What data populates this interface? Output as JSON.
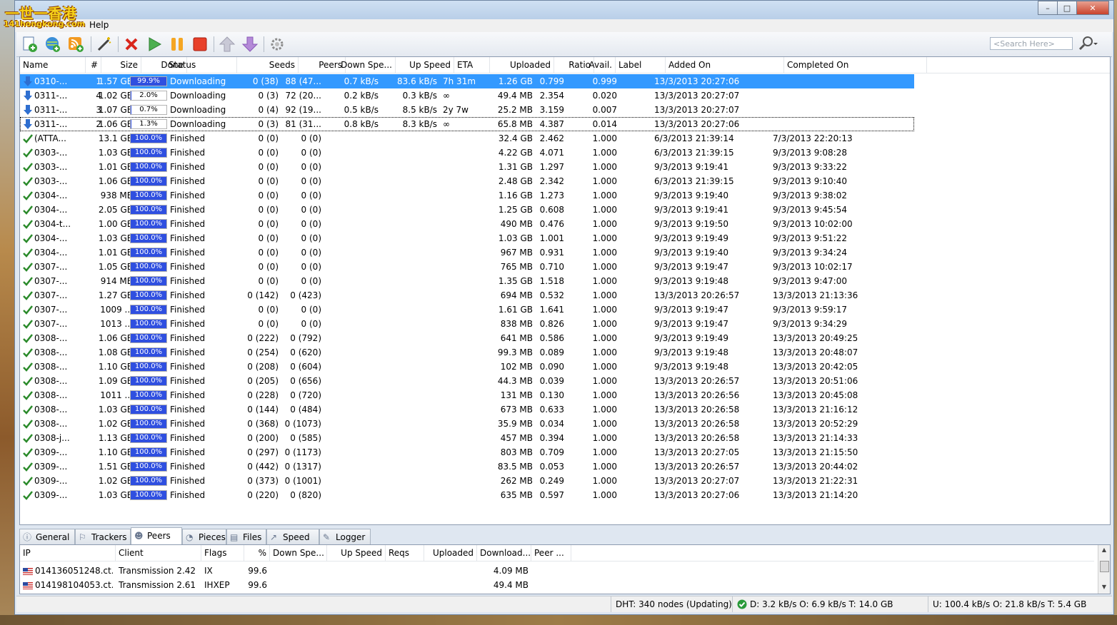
{
  "watermark": {
    "line1": "一世一香港",
    "line2": "141hongkong.com"
  },
  "menu": {
    "help": "Help"
  },
  "search": {
    "placeholder": "<Search Here>"
  },
  "columns": [
    {
      "key": "name",
      "label": "Name"
    },
    {
      "key": "num",
      "label": "#"
    },
    {
      "key": "size",
      "label": "Size"
    },
    {
      "key": "done",
      "label": "Done"
    },
    {
      "key": "status",
      "label": "Status"
    },
    {
      "key": "seeds",
      "label": "Seeds"
    },
    {
      "key": "peers",
      "label": "Peers"
    },
    {
      "key": "down",
      "label": "Down Spe..."
    },
    {
      "key": "up",
      "label": "Up Speed"
    },
    {
      "key": "eta",
      "label": "ETA"
    },
    {
      "key": "uploaded",
      "label": "Uploaded"
    },
    {
      "key": "ratio",
      "label": "Ratio"
    },
    {
      "key": "avail",
      "label": "Avail."
    },
    {
      "key": "label",
      "label": "Label"
    },
    {
      "key": "added",
      "label": "Added On"
    },
    {
      "key": "completed",
      "label": "Completed On"
    }
  ],
  "torrents": [
    {
      "icon": "download-arrow-icon",
      "name": "0310-...",
      "num": "1",
      "size": "1.57 GB",
      "done": "99.9%",
      "progress": 0.999,
      "status": "Downloading",
      "seeds": "0 (38)",
      "peers": "88 (47...",
      "down": "0.7 kB/s",
      "up": "83.6 kB/s",
      "eta": "7h 31m",
      "uploaded": "1.26 GB",
      "ratio": "0.799",
      "avail": "0.999",
      "added": "13/3/2013 20:27:06",
      "completed": ""
    },
    {
      "icon": "download-arrow-icon",
      "name": "0311-...",
      "num": "4",
      "size": "1.02 GB",
      "done": "2.0%",
      "progress": 0.02,
      "status": "Downloading",
      "seeds": "0 (3)",
      "peers": "72 (20...",
      "down": "0.2 kB/s",
      "up": "0.3 kB/s",
      "eta": "∞",
      "uploaded": "49.4 MB",
      "ratio": "2.354",
      "avail": "0.020",
      "added": "13/3/2013 20:27:07",
      "completed": ""
    },
    {
      "icon": "download-arrow-icon",
      "name": "0311-...",
      "num": "3",
      "size": "1.07 GB",
      "done": "0.7%",
      "progress": 0.007,
      "status": "Downloading",
      "seeds": "0 (4)",
      "peers": "92 (19...",
      "down": "0.5 kB/s",
      "up": "8.5 kB/s",
      "eta": "2y 7w",
      "uploaded": "25.2 MB",
      "ratio": "3.159",
      "avail": "0.007",
      "added": "13/3/2013 20:27:07",
      "completed": ""
    },
    {
      "icon": "download-arrow-icon",
      "name": "0311-...",
      "num": "2",
      "size": "1.06 GB",
      "done": "1.3%",
      "progress": 0.013,
      "status": "Downloading",
      "seeds": "0 (3)",
      "peers": "81 (31...",
      "down": "0.8 kB/s",
      "up": "8.3 kB/s",
      "eta": "∞",
      "uploaded": "65.8 MB",
      "ratio": "4.387",
      "avail": "0.014",
      "added": "13/3/2013 20:27:06",
      "completed": ""
    },
    {
      "icon": "check-icon",
      "name": "(ATTA...",
      "num": "",
      "size": "13.1 GB",
      "done": "100.0%",
      "progress": 1,
      "status": "Finished",
      "seeds": "0 (0)",
      "peers": "0 (0)",
      "down": "",
      "up": "",
      "eta": "",
      "uploaded": "32.4 GB",
      "ratio": "2.462",
      "avail": "1.000",
      "added": "6/3/2013 21:39:14",
      "completed": "7/3/2013 22:20:13"
    },
    {
      "icon": "check-icon",
      "name": "0303-...",
      "num": "",
      "size": "1.03 GB",
      "done": "100.0%",
      "progress": 1,
      "status": "Finished",
      "seeds": "0 (0)",
      "peers": "0 (0)",
      "down": "",
      "up": "",
      "eta": "",
      "uploaded": "4.22 GB",
      "ratio": "4.071",
      "avail": "1.000",
      "added": "6/3/2013 21:39:15",
      "completed": "9/3/2013 9:08:28"
    },
    {
      "icon": "check-icon",
      "name": "0303-...",
      "num": "",
      "size": "1.01 GB",
      "done": "100.0%",
      "progress": 1,
      "status": "Finished",
      "seeds": "0 (0)",
      "peers": "0 (0)",
      "down": "",
      "up": "",
      "eta": "",
      "uploaded": "1.31 GB",
      "ratio": "1.297",
      "avail": "1.000",
      "added": "9/3/2013 9:19:41",
      "completed": "9/3/2013 9:33:22"
    },
    {
      "icon": "check-icon",
      "name": "0303-...",
      "num": "",
      "size": "1.06 GB",
      "done": "100.0%",
      "progress": 1,
      "status": "Finished",
      "seeds": "0 (0)",
      "peers": "0 (0)",
      "down": "",
      "up": "",
      "eta": "",
      "uploaded": "2.48 GB",
      "ratio": "2.342",
      "avail": "1.000",
      "added": "6/3/2013 21:39:15",
      "completed": "9/3/2013 9:10:40"
    },
    {
      "icon": "check-icon",
      "name": "0304-...",
      "num": "",
      "size": "938 MB",
      "done": "100.0%",
      "progress": 1,
      "status": "Finished",
      "seeds": "0 (0)",
      "peers": "0 (0)",
      "down": "",
      "up": "",
      "eta": "",
      "uploaded": "1.16 GB",
      "ratio": "1.273",
      "avail": "1.000",
      "added": "9/3/2013 9:19:40",
      "completed": "9/3/2013 9:38:02"
    },
    {
      "icon": "check-icon",
      "name": "0304-...",
      "num": "",
      "size": "2.05 GB",
      "done": "100.0%",
      "progress": 1,
      "status": "Finished",
      "seeds": "0 (0)",
      "peers": "0 (0)",
      "down": "",
      "up": "",
      "eta": "",
      "uploaded": "1.25 GB",
      "ratio": "0.608",
      "avail": "1.000",
      "added": "9/3/2013 9:19:41",
      "completed": "9/3/2013 9:45:54"
    },
    {
      "icon": "check-icon",
      "name": "0304-t...",
      "num": "",
      "size": "1.00 GB",
      "done": "100.0%",
      "progress": 1,
      "status": "Finished",
      "seeds": "0 (0)",
      "peers": "0 (0)",
      "down": "",
      "up": "",
      "eta": "",
      "uploaded": "490 MB",
      "ratio": "0.476",
      "avail": "1.000",
      "added": "9/3/2013 9:19:50",
      "completed": "9/3/2013 10:02:00"
    },
    {
      "icon": "check-icon",
      "name": "0304-...",
      "num": "",
      "size": "1.03 GB",
      "done": "100.0%",
      "progress": 1,
      "status": "Finished",
      "seeds": "0 (0)",
      "peers": "0 (0)",
      "down": "",
      "up": "",
      "eta": "",
      "uploaded": "1.03 GB",
      "ratio": "1.001",
      "avail": "1.000",
      "added": "9/3/2013 9:19:49",
      "completed": "9/3/2013 9:51:22"
    },
    {
      "icon": "check-icon",
      "name": "0304-...",
      "num": "",
      "size": "1.01 GB",
      "done": "100.0%",
      "progress": 1,
      "status": "Finished",
      "seeds": "0 (0)",
      "peers": "0 (0)",
      "down": "",
      "up": "",
      "eta": "",
      "uploaded": "967 MB",
      "ratio": "0.931",
      "avail": "1.000",
      "added": "9/3/2013 9:19:40",
      "completed": "9/3/2013 9:34:24"
    },
    {
      "icon": "check-icon",
      "name": "0307-...",
      "num": "",
      "size": "1.05 GB",
      "done": "100.0%",
      "progress": 1,
      "status": "Finished",
      "seeds": "0 (0)",
      "peers": "0 (0)",
      "down": "",
      "up": "",
      "eta": "",
      "uploaded": "765 MB",
      "ratio": "0.710",
      "avail": "1.000",
      "added": "9/3/2013 9:19:47",
      "completed": "9/3/2013 10:02:17"
    },
    {
      "icon": "check-icon",
      "name": "0307-...",
      "num": "",
      "size": "914 MB",
      "done": "100.0%",
      "progress": 1,
      "status": "Finished",
      "seeds": "0 (0)",
      "peers": "0 (0)",
      "down": "",
      "up": "",
      "eta": "",
      "uploaded": "1.35 GB",
      "ratio": "1.518",
      "avail": "1.000",
      "added": "9/3/2013 9:19:48",
      "completed": "9/3/2013 9:47:00"
    },
    {
      "icon": "check-icon",
      "name": "0307-...",
      "num": "",
      "size": "1.27 GB",
      "done": "100.0%",
      "progress": 1,
      "status": "Finished",
      "seeds": "0 (142)",
      "peers": "0 (423)",
      "down": "",
      "up": "",
      "eta": "",
      "uploaded": "694 MB",
      "ratio": "0.532",
      "avail": "1.000",
      "added": "13/3/2013 20:26:57",
      "completed": "13/3/2013 21:13:36"
    },
    {
      "icon": "check-icon",
      "name": "0307-...",
      "num": "",
      "size": "1009 ...",
      "done": "100.0%",
      "progress": 1,
      "status": "Finished",
      "seeds": "0 (0)",
      "peers": "0 (0)",
      "down": "",
      "up": "",
      "eta": "",
      "uploaded": "1.61 GB",
      "ratio": "1.641",
      "avail": "1.000",
      "added": "9/3/2013 9:19:47",
      "completed": "9/3/2013 9:59:17"
    },
    {
      "icon": "check-icon",
      "name": "0307-...",
      "num": "",
      "size": "1013 ...",
      "done": "100.0%",
      "progress": 1,
      "status": "Finished",
      "seeds": "0 (0)",
      "peers": "0 (0)",
      "down": "",
      "up": "",
      "eta": "",
      "uploaded": "838 MB",
      "ratio": "0.826",
      "avail": "1.000",
      "added": "9/3/2013 9:19:47",
      "completed": "9/3/2013 9:34:29"
    },
    {
      "icon": "check-icon",
      "name": "0308-...",
      "num": "",
      "size": "1.06 GB",
      "done": "100.0%",
      "progress": 1,
      "status": "Finished",
      "seeds": "0 (222)",
      "peers": "0 (792)",
      "down": "",
      "up": "",
      "eta": "",
      "uploaded": "641 MB",
      "ratio": "0.586",
      "avail": "1.000",
      "added": "9/3/2013 9:19:49",
      "completed": "13/3/2013 20:49:25"
    },
    {
      "icon": "check-icon",
      "name": "0308-...",
      "num": "",
      "size": "1.08 GB",
      "done": "100.0%",
      "progress": 1,
      "status": "Finished",
      "seeds": "0 (254)",
      "peers": "0 (620)",
      "down": "",
      "up": "",
      "eta": "",
      "uploaded": "99.3 MB",
      "ratio": "0.089",
      "avail": "1.000",
      "added": "9/3/2013 9:19:48",
      "completed": "13/3/2013 20:48:07"
    },
    {
      "icon": "check-icon",
      "name": "0308-...",
      "num": "",
      "size": "1.10 GB",
      "done": "100.0%",
      "progress": 1,
      "status": "Finished",
      "seeds": "0 (208)",
      "peers": "0 (604)",
      "down": "",
      "up": "",
      "eta": "",
      "uploaded": "102 MB",
      "ratio": "0.090",
      "avail": "1.000",
      "added": "9/3/2013 9:19:48",
      "completed": "13/3/2013 20:42:05"
    },
    {
      "icon": "check-icon",
      "name": "0308-...",
      "num": "",
      "size": "1.09 GB",
      "done": "100.0%",
      "progress": 1,
      "status": "Finished",
      "seeds": "0 (205)",
      "peers": "0 (656)",
      "down": "",
      "up": "",
      "eta": "",
      "uploaded": "44.3 MB",
      "ratio": "0.039",
      "avail": "1.000",
      "added": "13/3/2013 20:26:57",
      "completed": "13/3/2013 20:51:06"
    },
    {
      "icon": "check-icon",
      "name": "0308-...",
      "num": "",
      "size": "1011 ...",
      "done": "100.0%",
      "progress": 1,
      "status": "Finished",
      "seeds": "0 (228)",
      "peers": "0 (720)",
      "down": "",
      "up": "",
      "eta": "",
      "uploaded": "131 MB",
      "ratio": "0.130",
      "avail": "1.000",
      "added": "13/3/2013 20:26:56",
      "completed": "13/3/2013 20:45:08"
    },
    {
      "icon": "check-icon",
      "name": "0308-...",
      "num": "",
      "size": "1.03 GB",
      "done": "100.0%",
      "progress": 1,
      "status": "Finished",
      "seeds": "0 (144)",
      "peers": "0 (484)",
      "down": "",
      "up": "",
      "eta": "",
      "uploaded": "673 MB",
      "ratio": "0.633",
      "avail": "1.000",
      "added": "13/3/2013 20:26:58",
      "completed": "13/3/2013 21:16:12"
    },
    {
      "icon": "check-icon",
      "name": "0308-...",
      "num": "",
      "size": "1.02 GB",
      "done": "100.0%",
      "progress": 1,
      "status": "Finished",
      "seeds": "0 (368)",
      "peers": "0 (1073)",
      "down": "",
      "up": "",
      "eta": "",
      "uploaded": "35.9 MB",
      "ratio": "0.034",
      "avail": "1.000",
      "added": "13/3/2013 20:26:58",
      "completed": "13/3/2013 20:52:29"
    },
    {
      "icon": "check-icon",
      "name": "0308-j...",
      "num": "",
      "size": "1.13 GB",
      "done": "100.0%",
      "progress": 1,
      "status": "Finished",
      "seeds": "0 (200)",
      "peers": "0 (585)",
      "down": "",
      "up": "",
      "eta": "",
      "uploaded": "457 MB",
      "ratio": "0.394",
      "avail": "1.000",
      "added": "13/3/2013 20:26:58",
      "completed": "13/3/2013 21:14:33"
    },
    {
      "icon": "check-icon",
      "name": "0309-...",
      "num": "",
      "size": "1.10 GB",
      "done": "100.0%",
      "progress": 1,
      "status": "Finished",
      "seeds": "0 (297)",
      "peers": "0 (1173)",
      "down": "",
      "up": "",
      "eta": "",
      "uploaded": "803 MB",
      "ratio": "0.709",
      "avail": "1.000",
      "added": "13/3/2013 20:27:05",
      "completed": "13/3/2013 21:15:50"
    },
    {
      "icon": "check-icon",
      "name": "0309-...",
      "num": "",
      "size": "1.51 GB",
      "done": "100.0%",
      "progress": 1,
      "status": "Finished",
      "seeds": "0 (442)",
      "peers": "0 (1317)",
      "down": "",
      "up": "",
      "eta": "",
      "uploaded": "83.5 MB",
      "ratio": "0.053",
      "avail": "1.000",
      "added": "13/3/2013 20:26:57",
      "completed": "13/3/2013 20:44:02"
    },
    {
      "icon": "check-icon",
      "name": "0309-...",
      "num": "",
      "size": "1.02 GB",
      "done": "100.0%",
      "progress": 1,
      "status": "Finished",
      "seeds": "0 (373)",
      "peers": "0 (1001)",
      "down": "",
      "up": "",
      "eta": "",
      "uploaded": "262 MB",
      "ratio": "0.249",
      "avail": "1.000",
      "added": "13/3/2013 20:27:07",
      "completed": "13/3/2013 21:22:31"
    },
    {
      "icon": "check-icon",
      "name": "0309-...",
      "num": "",
      "size": "1.03 GB",
      "done": "100.0%",
      "progress": 1,
      "status": "Finished",
      "seeds": "0 (220)",
      "peers": "0 (820)",
      "down": "",
      "up": "",
      "eta": "",
      "uploaded": "635 MB",
      "ratio": "0.597",
      "avail": "1.000",
      "added": "13/3/2013 20:27:06",
      "completed": "13/3/2013 21:14:20"
    }
  ],
  "tabs": [
    {
      "label": "General",
      "icon": "info-icon"
    },
    {
      "label": "Trackers",
      "icon": "trackers-icon"
    },
    {
      "label": "Peers",
      "icon": "peers-icon",
      "active": true
    },
    {
      "label": "Pieces",
      "icon": "pieces-icon"
    },
    {
      "label": "Files",
      "icon": "files-icon"
    },
    {
      "label": "Speed",
      "icon": "speed-icon"
    },
    {
      "label": "Logger",
      "icon": "logger-icon"
    }
  ],
  "peer_columns": [
    "IP",
    "Client",
    "Flags",
    "%",
    "Down Spe...",
    "Up Speed",
    "Reqs",
    "Uploaded",
    "Download...",
    "Peer ..."
  ],
  "peers": [
    {
      "ip": "014136051248.ct...",
      "client": "Transmission 2.42",
      "flags": "IX",
      "pct": "99.6",
      "down": "",
      "up": "",
      "reqs": "",
      "uploaded": "",
      "downloaded": "4.09 MB",
      "peer": ""
    },
    {
      "ip": "014198104053.ct...",
      "client": "Transmission 2.61",
      "flags": "IHXEP",
      "pct": "99.6",
      "down": "",
      "up": "",
      "reqs": "",
      "uploaded": "",
      "downloaded": "49.4 MB",
      "peer": ""
    }
  ],
  "status": {
    "dht": "DHT: 340 nodes (Updating)",
    "download": "D: 3.2 kB/s O: 6.9 kB/s T: 14.0 GB",
    "upload": "U: 100.4 kB/s O: 21.8 kB/s T: 5.4 GB"
  },
  "colors": {
    "selection": "#3399ff",
    "progress": "#2f4fe0",
    "finished_check": "#2a8a2a",
    "download_arrow": "#2f6fd0"
  }
}
